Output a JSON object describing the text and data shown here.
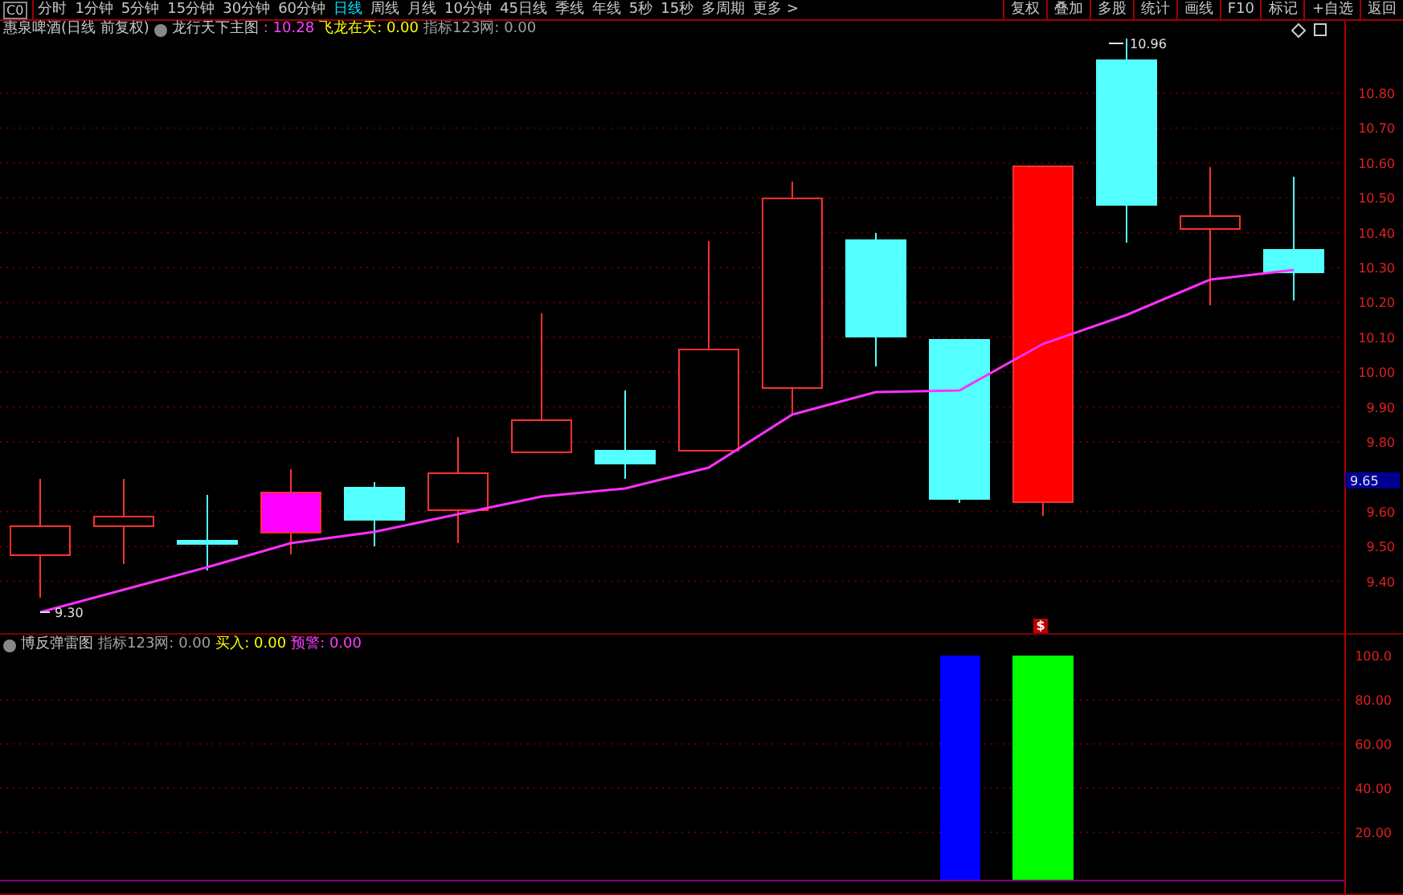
{
  "toolbar": {
    "chart_mode": "C0",
    "period_tabs": [
      {
        "label": "分时",
        "selected": false
      },
      {
        "label": "1分钟",
        "selected": false
      },
      {
        "label": "5分钟",
        "selected": false
      },
      {
        "label": "15分钟",
        "selected": false
      },
      {
        "label": "30分钟",
        "selected": false
      },
      {
        "label": "60分钟",
        "selected": false
      },
      {
        "label": "日线",
        "selected": true
      },
      {
        "label": "周线",
        "selected": false
      },
      {
        "label": "月线",
        "selected": false
      },
      {
        "label": "10分钟",
        "selected": false
      },
      {
        "label": "45日线",
        "selected": false
      },
      {
        "label": "季线",
        "selected": false
      },
      {
        "label": "年线",
        "selected": false
      },
      {
        "label": "5秒",
        "selected": false
      },
      {
        "label": "15秒",
        "selected": false
      },
      {
        "label": "多周期",
        "selected": false
      },
      {
        "label": "更多 >",
        "selected": false
      }
    ],
    "buttons": [
      "复权",
      "叠加",
      "多股",
      "统计",
      "画线",
      "F10",
      "标记",
      "+自选",
      "返回"
    ]
  },
  "main_chart": {
    "legend": {
      "title": "惠泉啤酒(日线 前复权)",
      "indicator": "龙行天下主图",
      "value": ": 10.28",
      "signal": "飞龙在天: 0.00",
      "source": "指标123网: 0.00"
    },
    "high_label": "10.96",
    "low_label": "9.30",
    "price_tag": "9.65",
    "y_axis_labels": [
      "10.80",
      "10.70",
      "10.60",
      "10.50",
      "10.40",
      "10.30",
      "10.20",
      "10.10",
      "10.00",
      "9.90",
      "9.80",
      "9.60",
      "9.50",
      "9.40"
    ]
  },
  "sub_chart": {
    "legend": {
      "title": "博反弹雷图",
      "source": "指标123网: 0.00",
      "buy": "买入: 0.00",
      "alert": "预警: 0.00"
    },
    "signal_mark": "$",
    "y_axis_labels": [
      "100.0",
      "80.00",
      "60.00",
      "40.00",
      "20.00"
    ]
  }
}
